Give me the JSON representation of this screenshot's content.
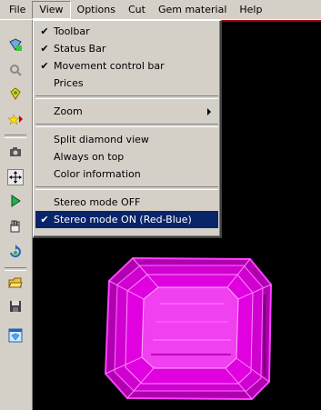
{
  "menubar": {
    "file": "File",
    "view": "View",
    "options": "Options",
    "cut": "Cut",
    "gem_material": "Gem material",
    "help": "Help"
  },
  "view_menu": {
    "toolbar": "Toolbar",
    "status_bar": "Status Bar",
    "movement_control_bar": "Movement control bar",
    "prices": "Prices",
    "zoom": "Zoom",
    "split_diamond_view": "Split diamond view",
    "always_on_top": "Always on top",
    "color_information": "Color information",
    "stereo_off": "Stereo mode OFF",
    "stereo_on": "Stereo mode ON (Red-Blue)",
    "check_mark": "✔"
  },
  "colors": {
    "gem": "#e000e0",
    "viewport_bg": "#000000",
    "highlight": "#0a246a"
  },
  "toolbar_icons": [
    "diamond-add-icon",
    "search-icon",
    "gem-settings-icon",
    "star-arrow-icon",
    "camera-icon",
    "move-icon",
    "play-icon",
    "hand-icon",
    "rotate-icon",
    "open-folder-icon",
    "save-icon",
    "gem-window-icon"
  ]
}
